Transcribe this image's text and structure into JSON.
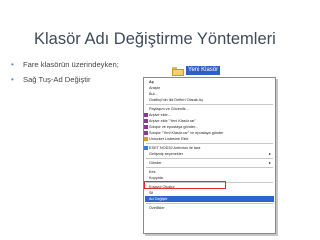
{
  "slide": {
    "title": "Klasör Adı Değiştirme Yöntemleri",
    "bullets": [
      "Fare klasörün üzerindeyken;",
      "Sağ Tuş-Ad Değiştir"
    ],
    "bullet_glyph": "•"
  },
  "folder": {
    "name": "Yeni Klasör",
    "icon": "folder-icon"
  },
  "context_menu": {
    "items": [
      {
        "label": "Aç",
        "bold": true
      },
      {
        "label": "Araştır"
      },
      {
        "label": "Bul..."
      },
      {
        "label": "Grafikçi'nin İkil Defteri Olarak Aç"
      },
      {
        "sep": true
      },
      {
        "label": "Paylaşım ve Güvenlik..."
      },
      {
        "label": "Arşive ekle...",
        "icon": "winrar"
      },
      {
        "label": "Arşive ekle \"Yeni Klasör.rar\"",
        "icon": "winrar"
      },
      {
        "label": "Sıkıştır ve epostaya gönder...",
        "icon": "winrar"
      },
      {
        "label": "Sıkıştır \"Yeni Klasör.rar\" ve epostaya gönder",
        "icon": "winrar"
      },
      {
        "label": "Unlocker Listesine Ekle",
        "icon": "unlocker"
      },
      {
        "sep": true
      },
      {
        "label": "ESET NOD32 Antivirus ile tara",
        "icon": "eset"
      },
      {
        "label": "Gelişmiş seçenekler",
        "arrow": "▸"
      },
      {
        "sep": true
      },
      {
        "label": "Gönder",
        "arrow": "▸"
      },
      {
        "sep": true
      },
      {
        "label": "Kes"
      },
      {
        "label": "Kopyala"
      },
      {
        "sep": true
      },
      {
        "label": "Kısayol Oluştur"
      },
      {
        "label": "Sil"
      },
      {
        "label": "Ad Değiştir",
        "selected": true
      },
      {
        "sep": true
      },
      {
        "label": "Özellikler"
      }
    ]
  },
  "colors": {
    "highlight": "#2f64cc",
    "callout_border": "#e02a2a",
    "title": "#3f4a5a"
  }
}
